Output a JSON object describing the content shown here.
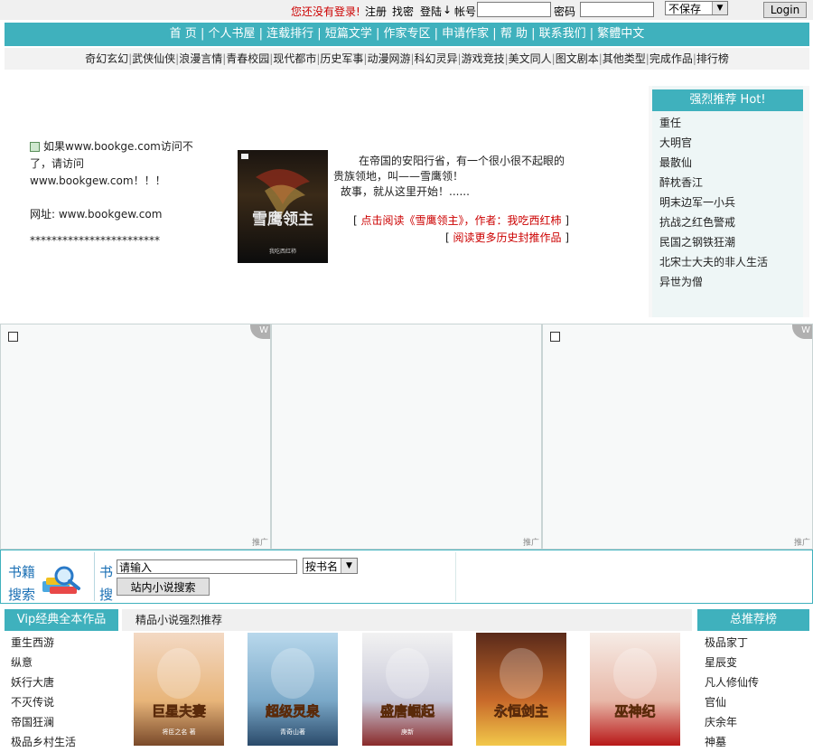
{
  "topbar": {
    "not_logged_in": "您还没有登录!",
    "register": "注册",
    "find_password": "找密",
    "login_link": "登陆",
    "arrow": "↓",
    "account_label": "帐号",
    "password_label": "密码",
    "save_option": "不保存",
    "login_button": "Login"
  },
  "main_nav": [
    "首 页",
    "个人书屋",
    "连载排行",
    "短篇文学",
    "作家专区",
    "申请作家",
    "帮 助",
    "联系我们",
    "繁體中文"
  ],
  "category_nav": [
    "奇幻玄幻",
    "武侠仙侠",
    "浪漫言情",
    "青春校园",
    "现代都市",
    "历史军事",
    "动漫网游",
    "科幻灵异",
    "游戏竞技",
    "美文同人",
    "图文剧本",
    "其他类型",
    "完成作品",
    "排行榜"
  ],
  "notice": {
    "line1": "如果www.bookge.com访问不了，请访问www.bookgew.com！！！",
    "line2": "网址: www.bookgew.com",
    "line3": "************************"
  },
  "featured": {
    "cover_title": "雪鹰领主",
    "cover_author": "我吃西红柿",
    "blurb_line1": "在帝国的安阳行省，有一个很小很不起眼的",
    "blurb_line2": "贵族领地，叫——雪鹰领！",
    "blurb_line3": "故事，就从这里开始！......",
    "read_link": "点击阅读《雪鹰领主》，作者：我吃西红柿",
    "more_link": "阅读更多历史封推作品"
  },
  "hot": {
    "title": "强烈推荐 Hot!",
    "items": [
      "重任",
      "大明官",
      "最散仙",
      "醉枕香江",
      "明末边军一小兵",
      "抗战之红色警戒",
      "民国之钢铁狂潮",
      "北宋士大夫的非人生活",
      "异世为僧"
    ]
  },
  "ads": {
    "corner": "W",
    "label": "推广"
  },
  "search": {
    "label": "书籍搜索",
    "label2": "书搜",
    "placeholder": "请输入",
    "type": "按书名",
    "button": "站内小说搜索"
  },
  "vip": {
    "title": "Vip经典全本作品",
    "items": [
      "重生西游",
      "纵意",
      "妖行大唐",
      "不灭传说",
      "帝国狂澜",
      "极品乡村生活"
    ]
  },
  "recommend": {
    "title": "精品小说强烈推荐",
    "covers": [
      {
        "title": "巨星夫妻",
        "author": "将臣之名 著",
        "colors": [
          "#f3d9c4",
          "#e8b57a",
          "#7a4a2a"
        ]
      },
      {
        "title": "超级灵泉",
        "author": "青奇山著",
        "colors": [
          "#b8d8ec",
          "#7aa8c8",
          "#2a4a6a"
        ]
      },
      {
        "title": "盛唐崛起",
        "author": "庚新",
        "colors": [
          "#f2f2f2",
          "#c8c8d8",
          "#8a2a2a"
        ]
      },
      {
        "title": "永恒剑主",
        "author": "",
        "colors": [
          "#5a2a1a",
          "#c86a2a",
          "#f2c84a"
        ]
      },
      {
        "title": "巫神纪",
        "author": "",
        "colors": [
          "#f6ece6",
          "#e8b8a8",
          "#b81818"
        ]
      }
    ]
  },
  "ranking": {
    "title": "总推荐榜",
    "items": [
      "极品家丁",
      "星辰变",
      "凡人修仙传",
      "官仙",
      "庆余年",
      "神墓"
    ]
  }
}
